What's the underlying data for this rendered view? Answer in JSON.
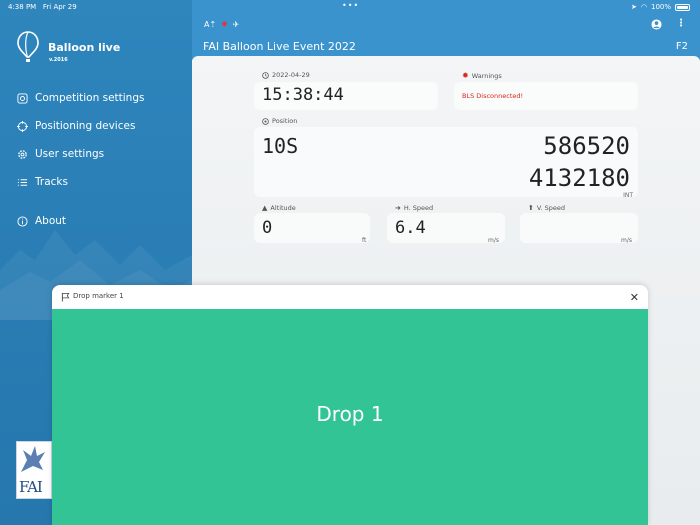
{
  "status": {
    "time": "4:38 PM",
    "date": "Fri Apr 29",
    "battery": "100%"
  },
  "app": {
    "name": "Balloon live",
    "version": "v.2016"
  },
  "menu": [
    {
      "label": "Competition settings",
      "icon": "competition-icon"
    },
    {
      "label": "Positioning devices",
      "icon": "crosshair-icon"
    },
    {
      "label": "User settings",
      "icon": "gear-icon"
    },
    {
      "label": "Tracks",
      "icon": "list-icon"
    },
    {
      "label": "About",
      "icon": "info-icon"
    }
  ],
  "logo_fai": "FAI",
  "header": {
    "title": "FAI Balloon Live Event 2022",
    "code": "F2"
  },
  "date": {
    "label": "2022-04-29",
    "time": "15:38:44"
  },
  "warnings": {
    "label": "Warnings",
    "text": "BLS Disconnected!"
  },
  "position": {
    "label": "Position",
    "zone": "10S",
    "easting": "586520",
    "northing": "4132180",
    "suffix": "INT"
  },
  "altitude": {
    "label": "Altitude",
    "value": "0",
    "unit": "ft"
  },
  "hspeed": {
    "label": "H. Speed",
    "value": "6.4",
    "unit": "m/s"
  },
  "vspeed": {
    "label": "V. Speed",
    "value": "",
    "unit": "m/s"
  },
  "modal": {
    "title": "Drop marker 1",
    "button": "Drop 1"
  },
  "colors": {
    "sidebar": "#2a7fb6",
    "header": "#3a93cd",
    "drop": "#32c494",
    "warning": "#d9261c"
  }
}
